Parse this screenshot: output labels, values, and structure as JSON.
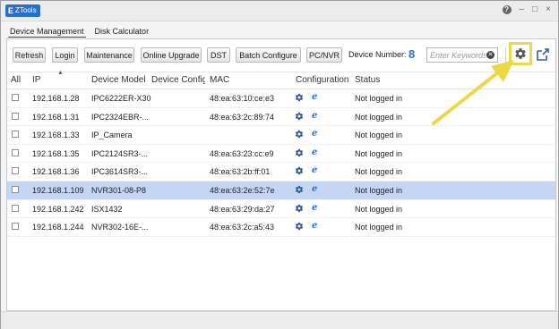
{
  "app": {
    "title": "EZTools",
    "logo_letter": "E",
    "logo_text": "ZTools"
  },
  "window_controls": {
    "help": "?",
    "minimize": "–",
    "maximize": "□",
    "close": "×"
  },
  "tabs": [
    {
      "label": "Device Management",
      "active": true
    },
    {
      "label": "Disk Calculator",
      "active": false
    }
  ],
  "toolbar": {
    "refresh": "Refresh",
    "login": "Login",
    "maintenance": "Maintenance",
    "online_upgrade": "Online Upgrade",
    "dst": "DST",
    "batch_configure": "Batch Configure",
    "pcnvr": "PC/NVR",
    "device_number_label": "Device Number:",
    "device_number": "8",
    "search_placeholder": "Enter Keywords",
    "search_value": "",
    "settings_icon": "gear-icon",
    "export_icon": "export-icon"
  },
  "columns": {
    "all": "All",
    "ip": "IP",
    "device_model": "Device Model",
    "device_config": "Device Config",
    "mac": "MAC",
    "configuration": "Configuration",
    "status": "Status"
  },
  "rows": [
    {
      "ip": "192.168.1.28",
      "model": "IPC6222ER-X30",
      "mac": "48:ea:63:10:ce:e3",
      "status": "Not logged in",
      "selected": false
    },
    {
      "ip": "192.168.1.31",
      "model": "IPC2324EBR-...",
      "mac": "48:ea:63:2c:89:74",
      "status": "Not logged in",
      "selected": false
    },
    {
      "ip": "192.168.1.33",
      "model": "IP_Camera",
      "mac": "",
      "status": "Not logged in",
      "selected": false
    },
    {
      "ip": "192.168.1.35",
      "model": "IPC2124SR3-...",
      "mac": "48:ea:63:23:cc:e9",
      "status": "Not logged in",
      "selected": false
    },
    {
      "ip": "192.168.1.36",
      "model": "IPC3614SR3-...",
      "mac": "48:ea:63:2b:ff:01",
      "status": "Not logged in",
      "selected": false
    },
    {
      "ip": "192.168.1.109",
      "model": "NVR301-08-P8",
      "mac": "48:ea:63:2e:52:7e",
      "status": "Not logged in",
      "selected": true
    },
    {
      "ip": "192.168.1.242",
      "model": "ISX1432",
      "mac": "48:ea:63:29:da:27",
      "status": "Not logged in",
      "selected": false
    },
    {
      "ip": "192.168.1.244",
      "model": "NVR302-16E-...",
      "mac": "48:ea:63:2c:a5:43",
      "status": "Not logged in",
      "selected": false
    }
  ],
  "colors": {
    "accent_blue": "#2b6fc2",
    "selected_row": "#c4d6f3",
    "highlight_yellow": "#e8d84a"
  }
}
